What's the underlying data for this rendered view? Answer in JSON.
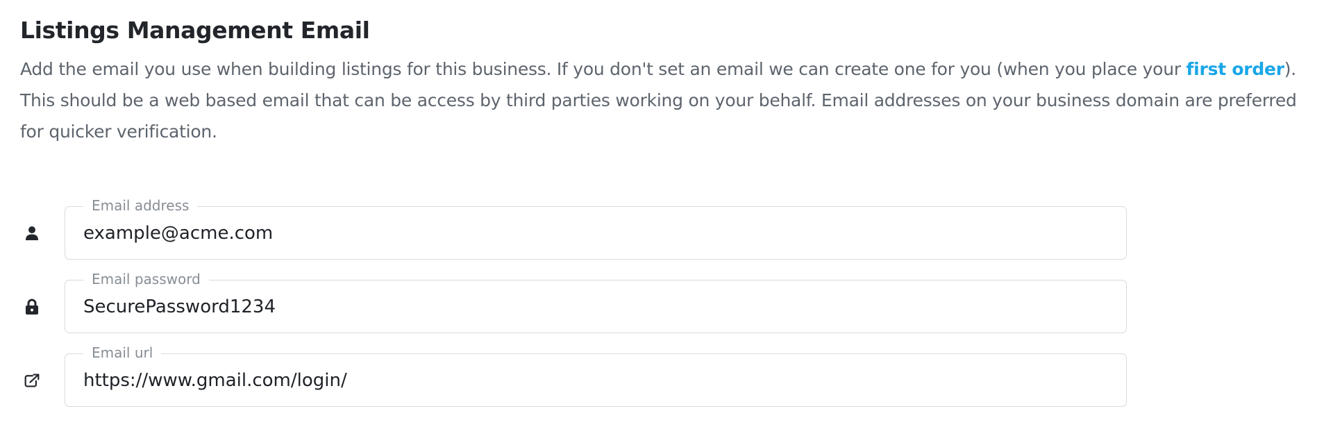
{
  "section": {
    "title": "Listings Management Email",
    "description_line1_before": "Add the email you use when building listings for this business. If you don't set an email we can create one for you (when you place your ",
    "description_link": "first order",
    "description_line1_after": ").",
    "description_line2": "This should be a web based email that can be access by third parties working on your behalf. Email addresses on your business domain are preferred for quicker verification."
  },
  "fields": {
    "email": {
      "label": "Email address",
      "value": "example@acme.com",
      "icon": "user-icon"
    },
    "password": {
      "label": "Email password",
      "value": "SecurePassword1234",
      "icon": "lock-icon"
    },
    "url": {
      "label": "Email url",
      "value": "https://www.gmail.com/login/",
      "icon": "external-link-icon"
    }
  },
  "colors": {
    "link": "#1aa6e8",
    "title": "#22262b",
    "body_text": "#5d646d",
    "field_border": "#d8dade",
    "legend_text": "#878d94",
    "input_text": "#1d2126"
  }
}
